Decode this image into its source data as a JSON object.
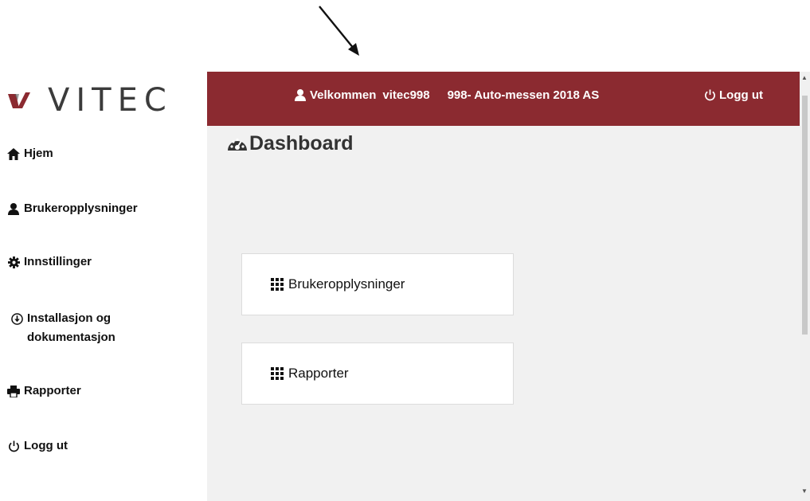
{
  "brand": {
    "name": "VITEC",
    "mark_color": "#8b2a30"
  },
  "colors": {
    "header_bg": "#8b2a30",
    "main_bg": "#f1f1f1",
    "tile_bg": "#ffffff"
  },
  "header": {
    "welcome": "Velkommen",
    "username": "vitec998",
    "company": "998- Auto-messen 2018 AS",
    "logout": "Logg ut"
  },
  "sidebar": {
    "items": [
      {
        "label": "Hjem",
        "icon": "home-icon"
      },
      {
        "label": "Brukeropplysninger",
        "icon": "user-icon"
      },
      {
        "label": "Innstillinger",
        "icon": "gear-icon"
      },
      {
        "label": "Installasjon og dokumentasjon",
        "icon": "download-circle-icon"
      },
      {
        "label": "Rapporter",
        "icon": "printer-icon"
      },
      {
        "label": "Logg ut",
        "icon": "power-icon"
      }
    ]
  },
  "main": {
    "title": "Dashboard",
    "title_icon": "dashboard-icon",
    "tiles": [
      {
        "label": "Brukeropplysninger",
        "icon": "grid-icon"
      },
      {
        "label": "Rapporter",
        "icon": "grid-icon"
      }
    ]
  }
}
